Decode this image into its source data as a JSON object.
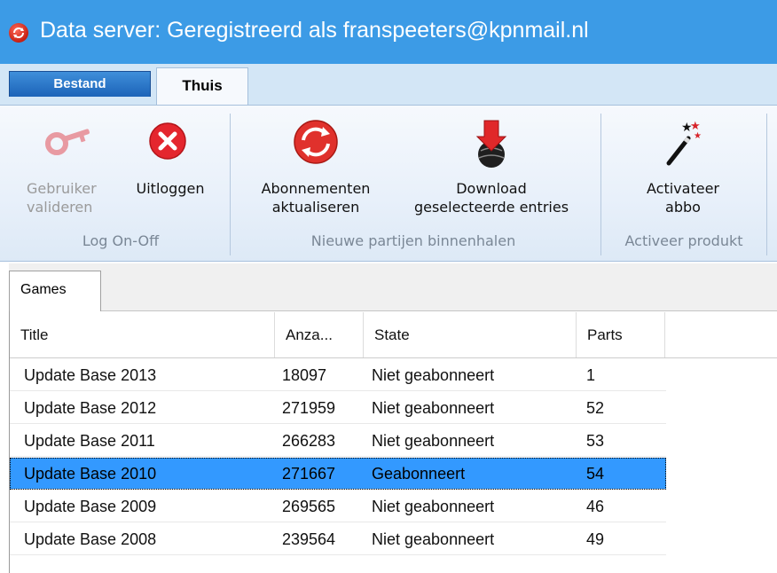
{
  "window": {
    "title": "Data server: Geregistreerd als franspeeters@kpnmail.nl",
    "app_icon": "refresh-icon"
  },
  "ribbon_tabs": [
    "Bestand",
    "Thuis"
  ],
  "ribbon": {
    "groups": [
      {
        "label": "Log On-Off",
        "buttons": [
          {
            "line1": "Gebruiker",
            "line2": "valideren",
            "icon": "key-icon",
            "enabled": false
          },
          {
            "line1": "Uitloggen",
            "line2": "",
            "icon": "close-circle-icon",
            "enabled": true
          }
        ]
      },
      {
        "label": "Nieuwe partijen binnenhalen",
        "buttons": [
          {
            "line1": "Abonnementen",
            "line2": "aktualiseren",
            "icon": "refresh-icon",
            "enabled": true
          },
          {
            "line1": "Download",
            "line2": "geselecteerde entries",
            "icon": "download-icon",
            "enabled": true
          }
        ]
      },
      {
        "label": "Activeer produkt",
        "buttons": [
          {
            "line1": "Activateer",
            "line2": "abbo",
            "icon": "magic-wand-icon",
            "enabled": true
          }
        ]
      }
    ]
  },
  "doc_tab": "Games",
  "table": {
    "columns": [
      "Title",
      "Anza...",
      "State",
      "Parts"
    ],
    "rows": [
      {
        "title": "Update Base 2013",
        "count": "18097",
        "state": "Niet geabonneert",
        "parts": "1",
        "selected": false
      },
      {
        "title": "Update Base 2012",
        "count": "271959",
        "state": "Niet geabonneert",
        "parts": "52",
        "selected": false
      },
      {
        "title": "Update Base 2011",
        "count": "266283",
        "state": "Niet geabonneert",
        "parts": "53",
        "selected": false
      },
      {
        "title": "Update Base 2010",
        "count": "271667",
        "state": "Geabonneert",
        "parts": "54",
        "selected": true
      },
      {
        "title": "Update Base 2009",
        "count": "269565",
        "state": "Niet geabonneert",
        "parts": "46",
        "selected": false
      },
      {
        "title": "Update Base 2008",
        "count": "239564",
        "state": "Niet geabonneert",
        "parts": "49",
        "selected": false
      }
    ]
  },
  "colors": {
    "titlebar": "#3c9be6",
    "selection": "#3399ff",
    "ribbon": "#e8f0fa"
  }
}
